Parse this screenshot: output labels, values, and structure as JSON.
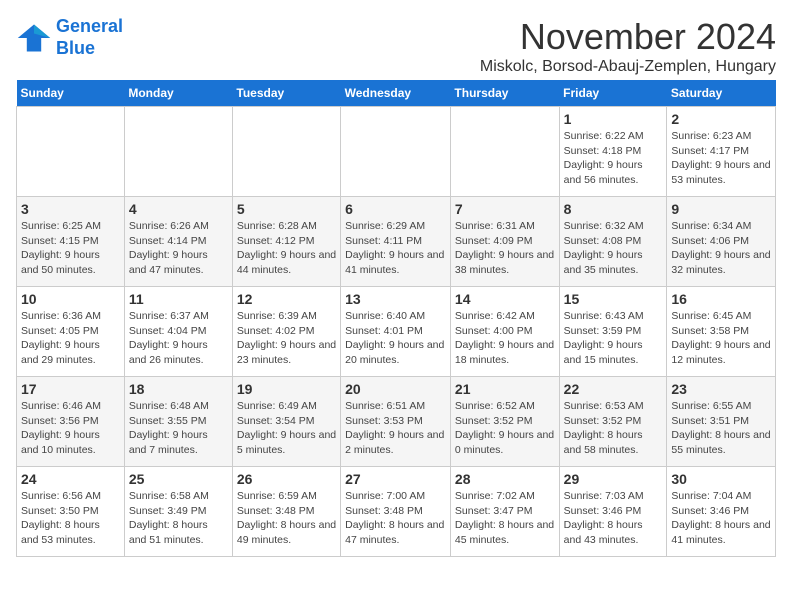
{
  "logo": {
    "line1": "General",
    "line2": "Blue"
  },
  "title": "November 2024",
  "subtitle": "Miskolc, Borsod-Abauj-Zemplen, Hungary",
  "weekdays": [
    "Sunday",
    "Monday",
    "Tuesday",
    "Wednesday",
    "Thursday",
    "Friday",
    "Saturday"
  ],
  "weeks": [
    [
      {
        "day": "",
        "info": ""
      },
      {
        "day": "",
        "info": ""
      },
      {
        "day": "",
        "info": ""
      },
      {
        "day": "",
        "info": ""
      },
      {
        "day": "",
        "info": ""
      },
      {
        "day": "1",
        "info": "Sunrise: 6:22 AM\nSunset: 4:18 PM\nDaylight: 9 hours and 56 minutes."
      },
      {
        "day": "2",
        "info": "Sunrise: 6:23 AM\nSunset: 4:17 PM\nDaylight: 9 hours and 53 minutes."
      }
    ],
    [
      {
        "day": "3",
        "info": "Sunrise: 6:25 AM\nSunset: 4:15 PM\nDaylight: 9 hours and 50 minutes."
      },
      {
        "day": "4",
        "info": "Sunrise: 6:26 AM\nSunset: 4:14 PM\nDaylight: 9 hours and 47 minutes."
      },
      {
        "day": "5",
        "info": "Sunrise: 6:28 AM\nSunset: 4:12 PM\nDaylight: 9 hours and 44 minutes."
      },
      {
        "day": "6",
        "info": "Sunrise: 6:29 AM\nSunset: 4:11 PM\nDaylight: 9 hours and 41 minutes."
      },
      {
        "day": "7",
        "info": "Sunrise: 6:31 AM\nSunset: 4:09 PM\nDaylight: 9 hours and 38 minutes."
      },
      {
        "day": "8",
        "info": "Sunrise: 6:32 AM\nSunset: 4:08 PM\nDaylight: 9 hours and 35 minutes."
      },
      {
        "day": "9",
        "info": "Sunrise: 6:34 AM\nSunset: 4:06 PM\nDaylight: 9 hours and 32 minutes."
      }
    ],
    [
      {
        "day": "10",
        "info": "Sunrise: 6:36 AM\nSunset: 4:05 PM\nDaylight: 9 hours and 29 minutes."
      },
      {
        "day": "11",
        "info": "Sunrise: 6:37 AM\nSunset: 4:04 PM\nDaylight: 9 hours and 26 minutes."
      },
      {
        "day": "12",
        "info": "Sunrise: 6:39 AM\nSunset: 4:02 PM\nDaylight: 9 hours and 23 minutes."
      },
      {
        "day": "13",
        "info": "Sunrise: 6:40 AM\nSunset: 4:01 PM\nDaylight: 9 hours and 20 minutes."
      },
      {
        "day": "14",
        "info": "Sunrise: 6:42 AM\nSunset: 4:00 PM\nDaylight: 9 hours and 18 minutes."
      },
      {
        "day": "15",
        "info": "Sunrise: 6:43 AM\nSunset: 3:59 PM\nDaylight: 9 hours and 15 minutes."
      },
      {
        "day": "16",
        "info": "Sunrise: 6:45 AM\nSunset: 3:58 PM\nDaylight: 9 hours and 12 minutes."
      }
    ],
    [
      {
        "day": "17",
        "info": "Sunrise: 6:46 AM\nSunset: 3:56 PM\nDaylight: 9 hours and 10 minutes."
      },
      {
        "day": "18",
        "info": "Sunrise: 6:48 AM\nSunset: 3:55 PM\nDaylight: 9 hours and 7 minutes."
      },
      {
        "day": "19",
        "info": "Sunrise: 6:49 AM\nSunset: 3:54 PM\nDaylight: 9 hours and 5 minutes."
      },
      {
        "day": "20",
        "info": "Sunrise: 6:51 AM\nSunset: 3:53 PM\nDaylight: 9 hours and 2 minutes."
      },
      {
        "day": "21",
        "info": "Sunrise: 6:52 AM\nSunset: 3:52 PM\nDaylight: 9 hours and 0 minutes."
      },
      {
        "day": "22",
        "info": "Sunrise: 6:53 AM\nSunset: 3:52 PM\nDaylight: 8 hours and 58 minutes."
      },
      {
        "day": "23",
        "info": "Sunrise: 6:55 AM\nSunset: 3:51 PM\nDaylight: 8 hours and 55 minutes."
      }
    ],
    [
      {
        "day": "24",
        "info": "Sunrise: 6:56 AM\nSunset: 3:50 PM\nDaylight: 8 hours and 53 minutes."
      },
      {
        "day": "25",
        "info": "Sunrise: 6:58 AM\nSunset: 3:49 PM\nDaylight: 8 hours and 51 minutes."
      },
      {
        "day": "26",
        "info": "Sunrise: 6:59 AM\nSunset: 3:48 PM\nDaylight: 8 hours and 49 minutes."
      },
      {
        "day": "27",
        "info": "Sunrise: 7:00 AM\nSunset: 3:48 PM\nDaylight: 8 hours and 47 minutes."
      },
      {
        "day": "28",
        "info": "Sunrise: 7:02 AM\nSunset: 3:47 PM\nDaylight: 8 hours and 45 minutes."
      },
      {
        "day": "29",
        "info": "Sunrise: 7:03 AM\nSunset: 3:46 PM\nDaylight: 8 hours and 43 minutes."
      },
      {
        "day": "30",
        "info": "Sunrise: 7:04 AM\nSunset: 3:46 PM\nDaylight: 8 hours and 41 minutes."
      }
    ]
  ]
}
